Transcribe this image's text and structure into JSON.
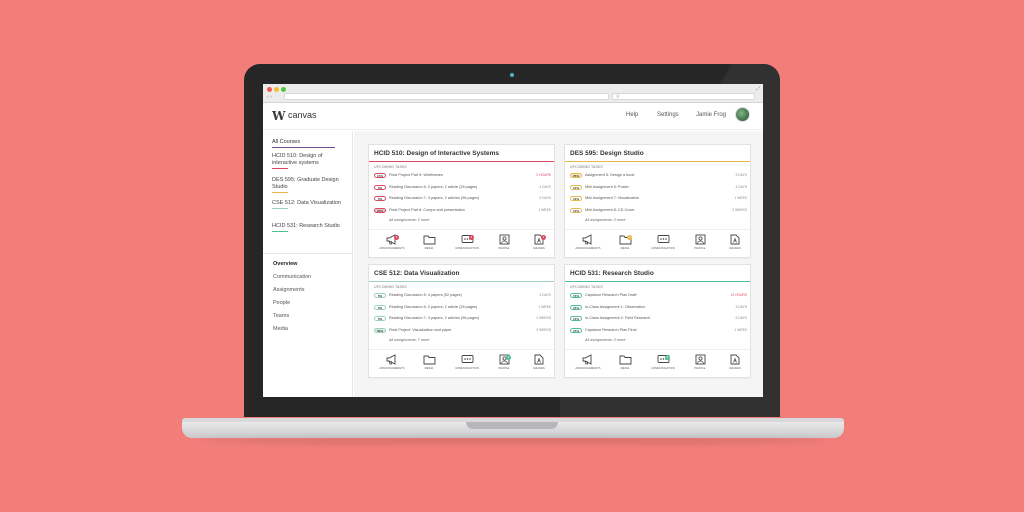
{
  "browser": {
    "url": "",
    "nav": "‹ ›"
  },
  "app": {
    "logo_letter": "W",
    "logo_text": "canvas"
  },
  "header": {
    "help": "Help",
    "settings": "Settings",
    "user": "Jamie Frog"
  },
  "sidebar": {
    "all_courses": "All Courses",
    "courses": [
      {
        "label": "HCID 510: Design of interactive systems",
        "color": "#d9485f"
      },
      {
        "label": "DES 595: Graduate Design Studio",
        "color": "#e8b84a"
      },
      {
        "label": "CSE 512: Data Visualization",
        "color": "#9ad3b7"
      },
      {
        "label": "HCID 531: Research Studio",
        "color": "#4fbf8f"
      }
    ],
    "nav": [
      "Overview",
      "Communication",
      "Assignments",
      "People",
      "Teams",
      "Media"
    ]
  },
  "cards": [
    {
      "title": "HCID 510: Design of Interactive Systems",
      "accent": "#d9485f",
      "upcoming_label": "UPCOMING TASKS",
      "tasks": [
        {
          "pct": "15%",
          "name": "Final Project Part 5: Wireframes",
          "due": "2 HOURS",
          "urgent": true
        },
        {
          "pct": "5%",
          "name": "Reading Discussion 6: 2 papers, 1 article (28 pages)",
          "due": "4 DAYS",
          "urgent": false
        },
        {
          "pct": "5%",
          "name": "Reading Discussion 7: 3 papers, 2 articles (56 pages)",
          "due": "5 DAYS",
          "urgent": false
        },
        {
          "pct": "25%",
          "name": "Final Project Part 6: Comps and presentation",
          "due": "1 WEEK",
          "urgent": false
        }
      ],
      "all_assignments": "All assignments: 2 more",
      "icons": [
        {
          "label": "ANNOUNCEMENTS",
          "badge": "2"
        },
        {
          "label": "MEDIA",
          "badge": ""
        },
        {
          "label": "COMMUNICATION",
          "badge": "4"
        },
        {
          "label": "PEOPLE",
          "badge": ""
        },
        {
          "label": "GRADES",
          "badge": "1"
        }
      ],
      "badge_color": "#d9485f"
    },
    {
      "title": "DES 595: Design Studio",
      "accent": "#e8b84a",
      "upcoming_label": "UPCOMING TASKS",
      "tasks": [
        {
          "pct": "25%",
          "name": "Assignment 5: Design a book",
          "due": "3 DAYS",
          "urgent": false
        },
        {
          "pct": "10%",
          "name": "Mini Assignment 6: Poster",
          "due": "4 DAYS",
          "urgent": false
        },
        {
          "pct": "10%",
          "name": "Mini Assignment 7: Visualization",
          "due": "1 WEEK",
          "urgent": false
        },
        {
          "pct": "10%",
          "name": "Mini Assignment 8: CD Cover",
          "due": "2 WEEKS",
          "urgent": false
        }
      ],
      "all_assignments": "All assignments: 2 more",
      "icons": [
        {
          "label": "ANNOUNCEMENTS",
          "badge": ""
        },
        {
          "label": "MEDIA",
          "badge": "1"
        },
        {
          "label": "COMMUNICATION",
          "badge": ""
        },
        {
          "label": "PEOPLE",
          "badge": ""
        },
        {
          "label": "GRADES",
          "badge": ""
        }
      ],
      "badge_color": "#e8b84a"
    },
    {
      "title": "CSE 512: Data Visualization",
      "accent": "#9ad3b7",
      "upcoming_label": "UPCOMING TASKS",
      "tasks": [
        {
          "pct": "5%",
          "name": "Reading Discussion 5: 4 papers (52 pages)",
          "due": "3 DAYS",
          "urgent": false
        },
        {
          "pct": "5%",
          "name": "Reading Discussion 6: 2 papers, 1 article (28 pages)",
          "due": "1 WEEK",
          "urgent": false
        },
        {
          "pct": "5%",
          "name": "Reading Discussion 7: 3 papers, 2 articles (56 pages)",
          "due": "2 WEEKS",
          "urgent": false
        },
        {
          "pct": "50%",
          "name": "Final Project: Visualization and paper",
          "due": "3 WEEKS",
          "urgent": false
        }
      ],
      "all_assignments": "All assignments: 7 more",
      "icons": [
        {
          "label": "ANNOUNCEMENTS",
          "badge": ""
        },
        {
          "label": "MEDIA",
          "badge": ""
        },
        {
          "label": "COMMUNICATION",
          "badge": ""
        },
        {
          "label": "PEOPLE",
          "badge": "1"
        },
        {
          "label": "GRADES",
          "badge": ""
        }
      ],
      "badge_color": "#4fbf8f"
    },
    {
      "title": "HCID 531: Research Studio",
      "accent": "#4fbf8f",
      "upcoming_label": "UPCOMING TASKS",
      "tasks": [
        {
          "pct": "15%",
          "name": "Capstone Research Plan Draft",
          "due": "12 HOURS",
          "urgent": true
        },
        {
          "pct": "15%",
          "name": "In-Class Assignment 1: Observation",
          "due": "3 DAYS",
          "urgent": false
        },
        {
          "pct": "15%",
          "name": "In-Class Assignment 2: Field Research",
          "due": "5 DAYS",
          "urgent": false
        },
        {
          "pct": "15%",
          "name": "Capstone Research Plan Final",
          "due": "1 WEEK",
          "urgent": false
        }
      ],
      "all_assignments": "All assignments: 2 more",
      "icons": [
        {
          "label": "ANNOUNCEMENTS",
          "badge": ""
        },
        {
          "label": "MEDIA",
          "badge": ""
        },
        {
          "label": "COMMUNICATION",
          "badge": "2"
        },
        {
          "label": "PEOPLE",
          "badge": ""
        },
        {
          "label": "GRADES",
          "badge": ""
        }
      ],
      "badge_color": "#4fbf8f"
    }
  ],
  "colors": {
    "background": "#f27e7a",
    "brand_purple": "#6b4d8e"
  }
}
